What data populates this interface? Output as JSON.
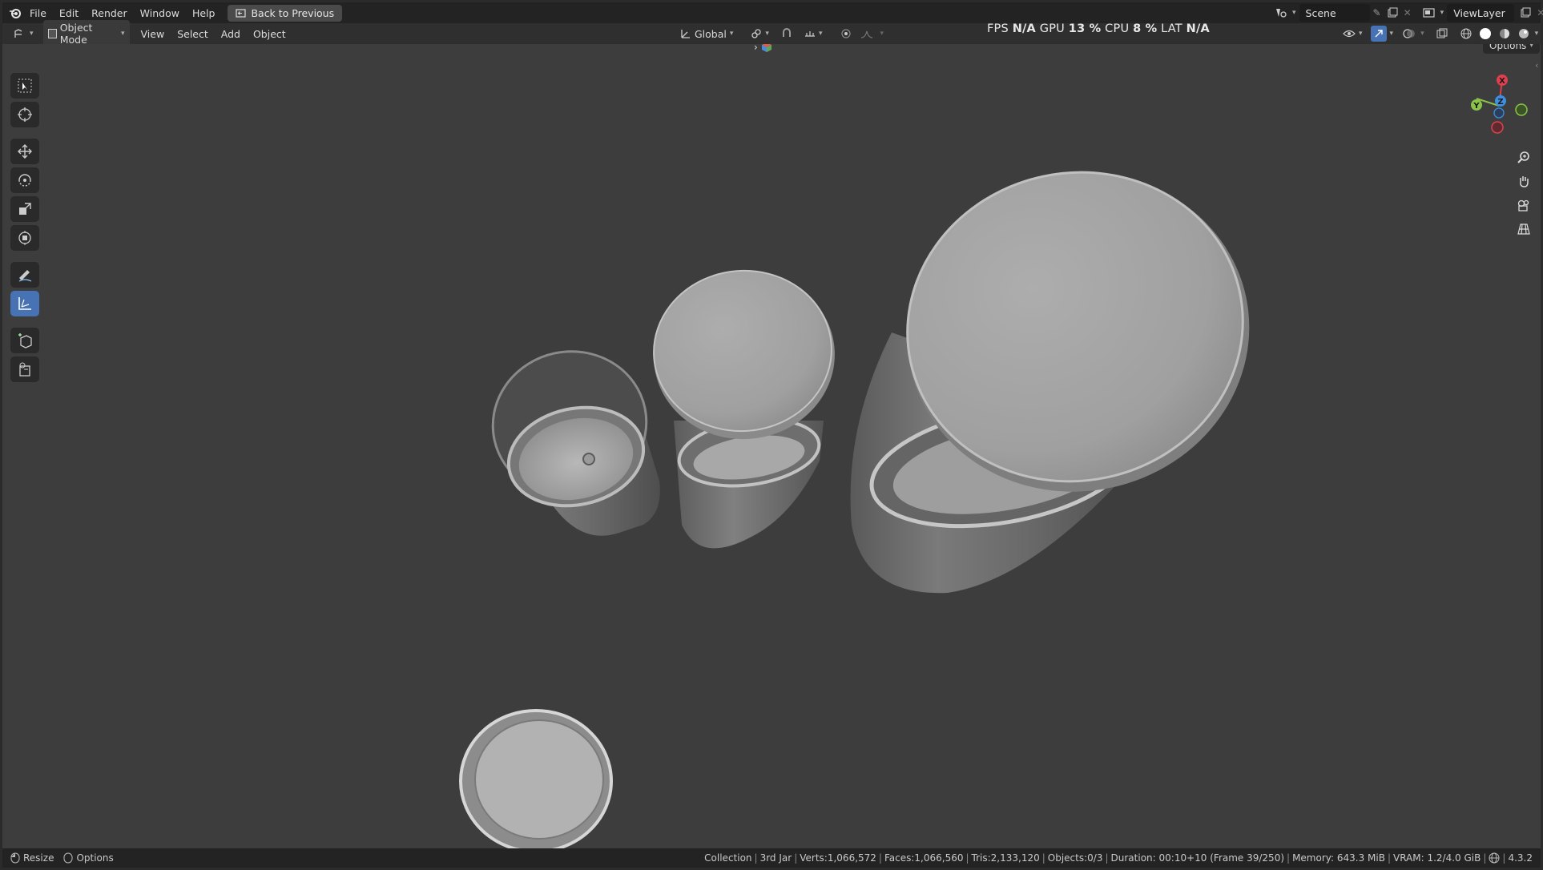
{
  "menubar": {
    "items": [
      "File",
      "Edit",
      "Render",
      "Window",
      "Help"
    ],
    "back_button": "Back to Previous",
    "scene_label": "Scene",
    "view_layer_label": "ViewLayer"
  },
  "header": {
    "mode": "Object Mode",
    "menus": [
      "View",
      "Select",
      "Add",
      "Object"
    ],
    "orientation": "Global",
    "options_label": "Options"
  },
  "perf": {
    "fps_label": "FPS",
    "fps_value": "N/A",
    "gpu_label": "GPU",
    "gpu_value": "13 %",
    "cpu_label": "CPU",
    "cpu_value": "8 %",
    "lat_label": "LAT",
    "lat_value": "N/A"
  },
  "gizmo": {
    "x": "X",
    "y": "Y",
    "z": "Z"
  },
  "statusbar": {
    "left": [
      "Resize",
      "Options"
    ],
    "collection": "Collection",
    "object": "3rd Jar",
    "verts": "Verts:1,066,572",
    "faces": "Faces:1,066,560",
    "tris": "Tris:2,133,120",
    "objects": "Objects:0/3",
    "duration": "Duration: 00:10+10 (Frame 39/250)",
    "memory": "Memory: 643.3 MiB",
    "vram": "VRAM: 1.2/4.0 GiB",
    "version": "4.3.2"
  },
  "colors": {
    "accent": "#4772b3",
    "axis_x": "#e0404e",
    "axis_y": "#8bc34a",
    "axis_z": "#3d8fe0"
  }
}
